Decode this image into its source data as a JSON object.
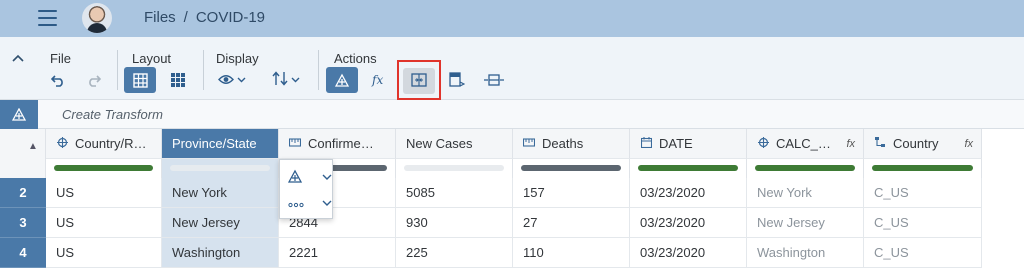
{
  "shell": {
    "breadcrumb_root": "Files",
    "breadcrumb_sep": "/",
    "breadcrumb_current": "COVID-19"
  },
  "toolbar": {
    "collapse_icon": "chevron-up-icon",
    "groups": {
      "file": "File",
      "layout": "Layout",
      "display": "Display",
      "actions": "Actions"
    }
  },
  "transform": {
    "placeholder": "Create Transform"
  },
  "grid": {
    "columns": [
      {
        "label": "Country/R…",
        "icon": "geo-icon",
        "quality_color": "#3e7b35"
      },
      {
        "label": "Province/State",
        "icon": "",
        "quality_color": "#e6ebef"
      },
      {
        "label": "Confirme…",
        "icon": "measure-icon",
        "quality_color": "#5c6670"
      },
      {
        "label": "New Cases",
        "icon": "",
        "quality_color": "#e8ebee"
      },
      {
        "label": "Deaths",
        "icon": "measure-icon",
        "quality_color": "#5c6670"
      },
      {
        "label": "DATE",
        "icon": "calendar-icon",
        "quality_color": "#3e7b35"
      },
      {
        "label": "CALC_…",
        "icon": "geo-icon",
        "fx": "fx",
        "quality_color": "#3e7b35"
      },
      {
        "label": "Country",
        "icon": "hierarchy-icon",
        "fx": "fx",
        "quality_color": "#3e7b35"
      }
    ],
    "rows": [
      {
        "num": "2",
        "cells": [
          "US",
          "New York",
          "",
          "5085",
          "157",
          "03/23/2020",
          "New York",
          "C_US"
        ]
      },
      {
        "num": "3",
        "cells": [
          "US",
          "New Jersey",
          "2844",
          "930",
          "27",
          "03/23/2020",
          "New Jersey",
          "C_US"
        ]
      },
      {
        "num": "4",
        "cells": [
          "US",
          "Washington",
          "2221",
          "225",
          "110",
          "03/23/2020",
          "Washington",
          "C_US"
        ]
      }
    ]
  },
  "colors": {
    "shell_bg": "#aac5e0",
    "accent": "#4a79a8",
    "highlight_box": "#e0342c",
    "quality_green": "#3e7b35"
  }
}
